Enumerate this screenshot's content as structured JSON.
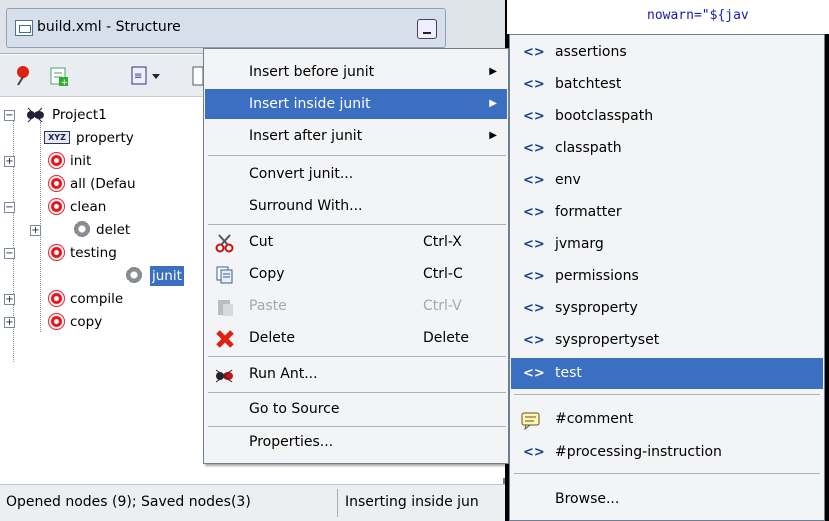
{
  "panel": {
    "title": "build.xml - Structure"
  },
  "editor": {
    "code": "nowarn=\"${jav"
  },
  "tree": {
    "items": [
      {
        "label": "Project1"
      },
      {
        "label": "property"
      },
      {
        "label": "init"
      },
      {
        "label": "all (Defau"
      },
      {
        "label": "clean"
      },
      {
        "label": "delet"
      },
      {
        "label": "testing"
      },
      {
        "label": "junit"
      },
      {
        "label": "compile"
      },
      {
        "label": "copy"
      }
    ]
  },
  "context_menu": {
    "items": [
      {
        "label": "Insert before junit"
      },
      {
        "label": "Insert inside junit"
      },
      {
        "label": "Insert after junit"
      },
      {
        "label": "Convert junit..."
      },
      {
        "label": "Surround With..."
      },
      {
        "label": "Cut",
        "accel": "Ctrl-X"
      },
      {
        "label": "Copy",
        "accel": "Ctrl-C"
      },
      {
        "label": "Paste",
        "accel": "Ctrl-V"
      },
      {
        "label": "Delete",
        "accel": "Delete"
      },
      {
        "label": "Run Ant..."
      },
      {
        "label": "Go to Source"
      },
      {
        "label": "Properties..."
      }
    ]
  },
  "submenu": {
    "tag_glyph": "<>",
    "items": [
      {
        "label": "assertions"
      },
      {
        "label": "batchtest"
      },
      {
        "label": "bootclasspath"
      },
      {
        "label": "classpath"
      },
      {
        "label": "env"
      },
      {
        "label": "formatter"
      },
      {
        "label": "jvmarg"
      },
      {
        "label": "permissions"
      },
      {
        "label": "sysproperty"
      },
      {
        "label": "syspropertyset"
      },
      {
        "label": "test"
      },
      {
        "label": "#comment"
      },
      {
        "label": "#processing-instruction"
      },
      {
        "label": "Browse..."
      }
    ]
  },
  "status": {
    "left": "Opened nodes (9); Saved nodes(3)",
    "right": "Inserting inside jun"
  },
  "colors": {
    "highlight": "#3a6fc1",
    "target_red": "#e8111a"
  }
}
